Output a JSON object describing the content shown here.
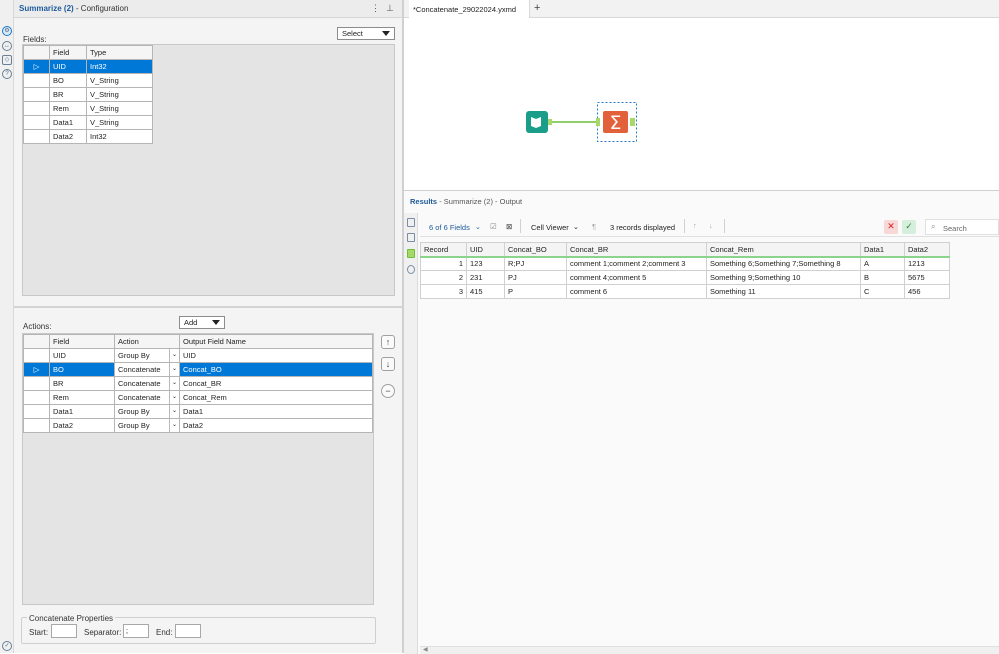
{
  "config": {
    "title_bold": "Summarize (2)",
    "title_rest": "- Configuration",
    "fields_label": "Fields:",
    "select_button": "Select",
    "fields_table": {
      "headers": [
        "Field",
        "Type"
      ],
      "rows": [
        {
          "field": "UID",
          "type": "Int32",
          "selected": true
        },
        {
          "field": "BO",
          "type": "V_String"
        },
        {
          "field": "BR",
          "type": "V_String"
        },
        {
          "field": "Rem",
          "type": "V_String"
        },
        {
          "field": "Data1",
          "type": "V_String"
        },
        {
          "field": "Data2",
          "type": "Int32"
        }
      ]
    },
    "actions_label": "Actions:",
    "add_button": "Add",
    "actions_table": {
      "headers": [
        "Field",
        "Action",
        "Output Field Name"
      ],
      "rows": [
        {
          "field": "UID",
          "action": "Group By",
          "output": "UID"
        },
        {
          "field": "BO",
          "action": "Concatenate",
          "output": "Concat_BO",
          "selected": true
        },
        {
          "field": "BR",
          "action": "Concatenate",
          "output": "Concat_BR"
        },
        {
          "field": "Rem",
          "action": "Concatenate",
          "output": "Concat_Rem"
        },
        {
          "field": "Data1",
          "action": "Group By",
          "output": "Data1"
        },
        {
          "field": "Data2",
          "action": "Group By",
          "output": "Data2"
        }
      ]
    },
    "concat_props": {
      "title": "Concatenate Properties",
      "start_label": "Start:",
      "start_value": "",
      "separator_label": "Separator:",
      "separator_value": ";",
      "end_label": "End:",
      "end_value": ""
    }
  },
  "workflow_tab": "*Concatenate_29022024.yxmd",
  "tab_add": "+",
  "results": {
    "title_bold": "Results",
    "title_rest": "- Summarize (2) - Output",
    "fields_count": "6 of 6 Fields",
    "cell_viewer": "Cell Viewer",
    "records_displayed": "3 records displayed",
    "search_placeholder": "Search",
    "headers": [
      "Record",
      "UID",
      "Concat_BO",
      "Concat_BR",
      "Concat_Rem",
      "Data1",
      "Data2"
    ],
    "rows": [
      [
        "1",
        "123",
        "R;PJ",
        "comment 1;comment 2;comment 3",
        "Something 6;Something 7;Something 8",
        "A",
        "1213"
      ],
      [
        "2",
        "231",
        "PJ",
        "comment 4;comment 5",
        "Something 9;Something 10",
        "B",
        "5675"
      ],
      [
        "3",
        "415",
        "P",
        "comment 6",
        "Something 11",
        "C",
        "456"
      ]
    ]
  },
  "colors": {
    "accent": "#0078d7",
    "input_tool": "#1a9e8a",
    "summarize_tool": "#e2603a",
    "connector": "#6cbf3a"
  }
}
